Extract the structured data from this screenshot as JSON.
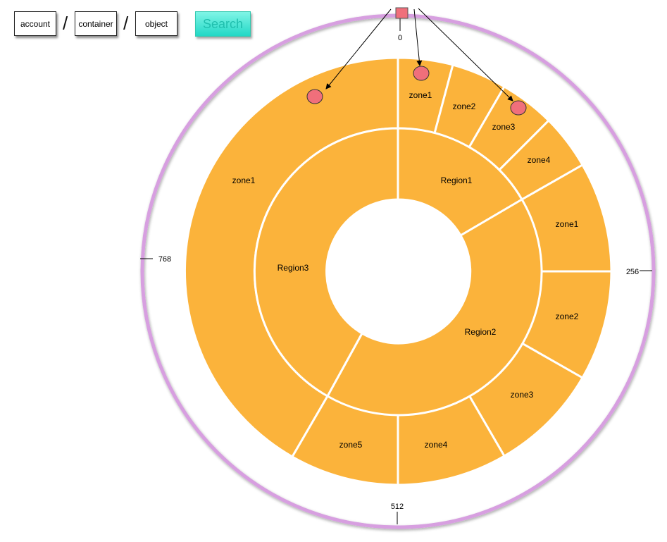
{
  "toolbar": {
    "path_segments": [
      "account",
      "container",
      "object"
    ],
    "separator": "/",
    "search_label": "Search"
  },
  "ring": {
    "ticks": [
      "0",
      "256",
      "512",
      "768"
    ]
  },
  "regions": [
    {
      "label": "Region1",
      "zones": [
        "zone1",
        "zone2",
        "zone3",
        "zone4"
      ]
    },
    {
      "label": "Region2",
      "zones": [
        "zone1",
        "zone2",
        "zone3",
        "zone4",
        "zone5"
      ]
    },
    {
      "label": "Region3",
      "zones": [
        "zone1"
      ]
    }
  ],
  "colors": {
    "segment_fill": "#FBB33B",
    "ring_stroke": "#D79FE0",
    "marker_fill": "#F06F7B",
    "search_button": "#22D8C6"
  }
}
